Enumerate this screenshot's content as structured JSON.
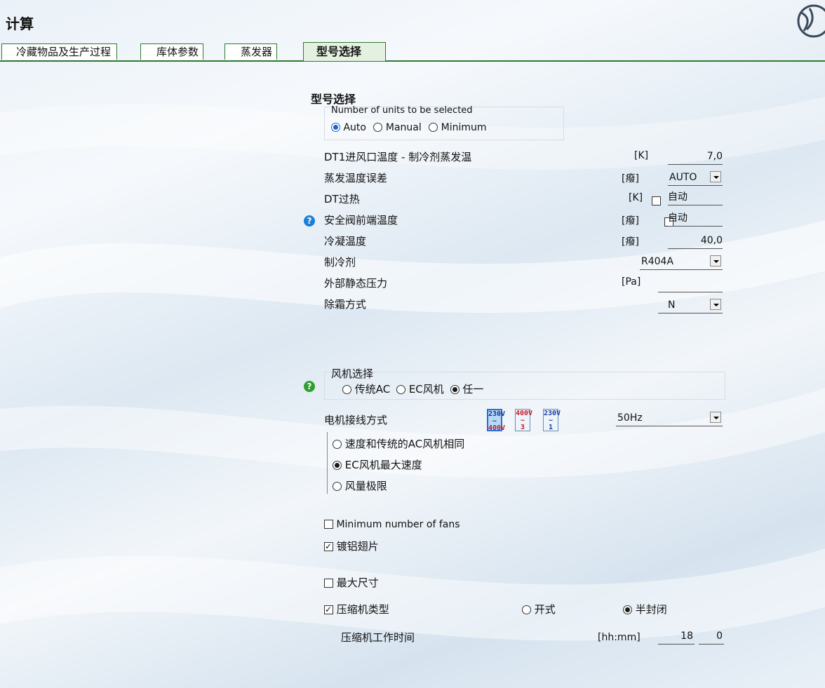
{
  "window": {
    "title": "计算"
  },
  "tabs": [
    {
      "label": "冷藏物品及生产过程",
      "active": false
    },
    {
      "label": "库体参数",
      "active": false
    },
    {
      "label": "蒸发器",
      "active": false
    },
    {
      "label": "型号选择",
      "active": true
    }
  ],
  "section_title": "型号选择",
  "units": {
    "legend": "Number of units to be selected",
    "options": [
      "Auto",
      "Manual",
      "Minimum"
    ],
    "selected": "Auto"
  },
  "params": [
    {
      "label": "DT1进风口温度 - 制冷剂蒸发温",
      "unit": "[K]",
      "value": "7,0"
    },
    {
      "label": "蒸发温度误差",
      "unit": "[癈]",
      "value": "AUTO"
    },
    {
      "label": "DT过热",
      "unit": "[K]",
      "value": "自动"
    },
    {
      "label": "安全阀前端温度",
      "unit": "[癈]",
      "value": "自动"
    },
    {
      "label": "冷凝温度",
      "unit": "[癈]",
      "value": "40,0"
    },
    {
      "label": "制冷剂",
      "unit": "",
      "value": "R404A"
    },
    {
      "label": "外部静态压力",
      "unit": "[Pa]",
      "value": ""
    },
    {
      "label": "除霜方式",
      "unit": "",
      "value": "N"
    }
  ],
  "fan": {
    "legend": "风机选择",
    "options": [
      "传统AC",
      "EC风机",
      "任一"
    ],
    "selected": "任一"
  },
  "motor": {
    "label": "电机接线方式",
    "badges": [
      {
        "top": "230V",
        "mid": "~",
        "bot": "400V"
      },
      {
        "top": "400V",
        "mid": "~",
        "bot": "3"
      },
      {
        "top": "230V",
        "mid": "~",
        "bot": "1"
      }
    ],
    "freq": "50Hz",
    "speed_options": [
      "速度和传统的AC风机相同",
      "EC风机最大速度",
      "风量极限"
    ],
    "speed_selected": "EC风机最大速度"
  },
  "options": {
    "min_fans": {
      "label": "Minimum number of fans",
      "checked": false
    },
    "aluminum_fins": {
      "label": "镀铝翅片",
      "checked": true
    },
    "max_size": {
      "label": "最大尺寸",
      "checked": false
    },
    "compressor_type": {
      "label": "压缩机类型",
      "checked": true,
      "open_label": "开式",
      "semi_label": "半封闭",
      "selected": "半封闭"
    }
  },
  "runtime": {
    "label": "压缩机工作时间",
    "unit": "[hh:mm]",
    "hours": "18",
    "minutes": "0"
  },
  "colors": {
    "tab_green": "#2f7a2f",
    "help_blue": "#1b7fd6",
    "help_green": "#2e9e2e",
    "radio_blue": "#1b62c8"
  }
}
